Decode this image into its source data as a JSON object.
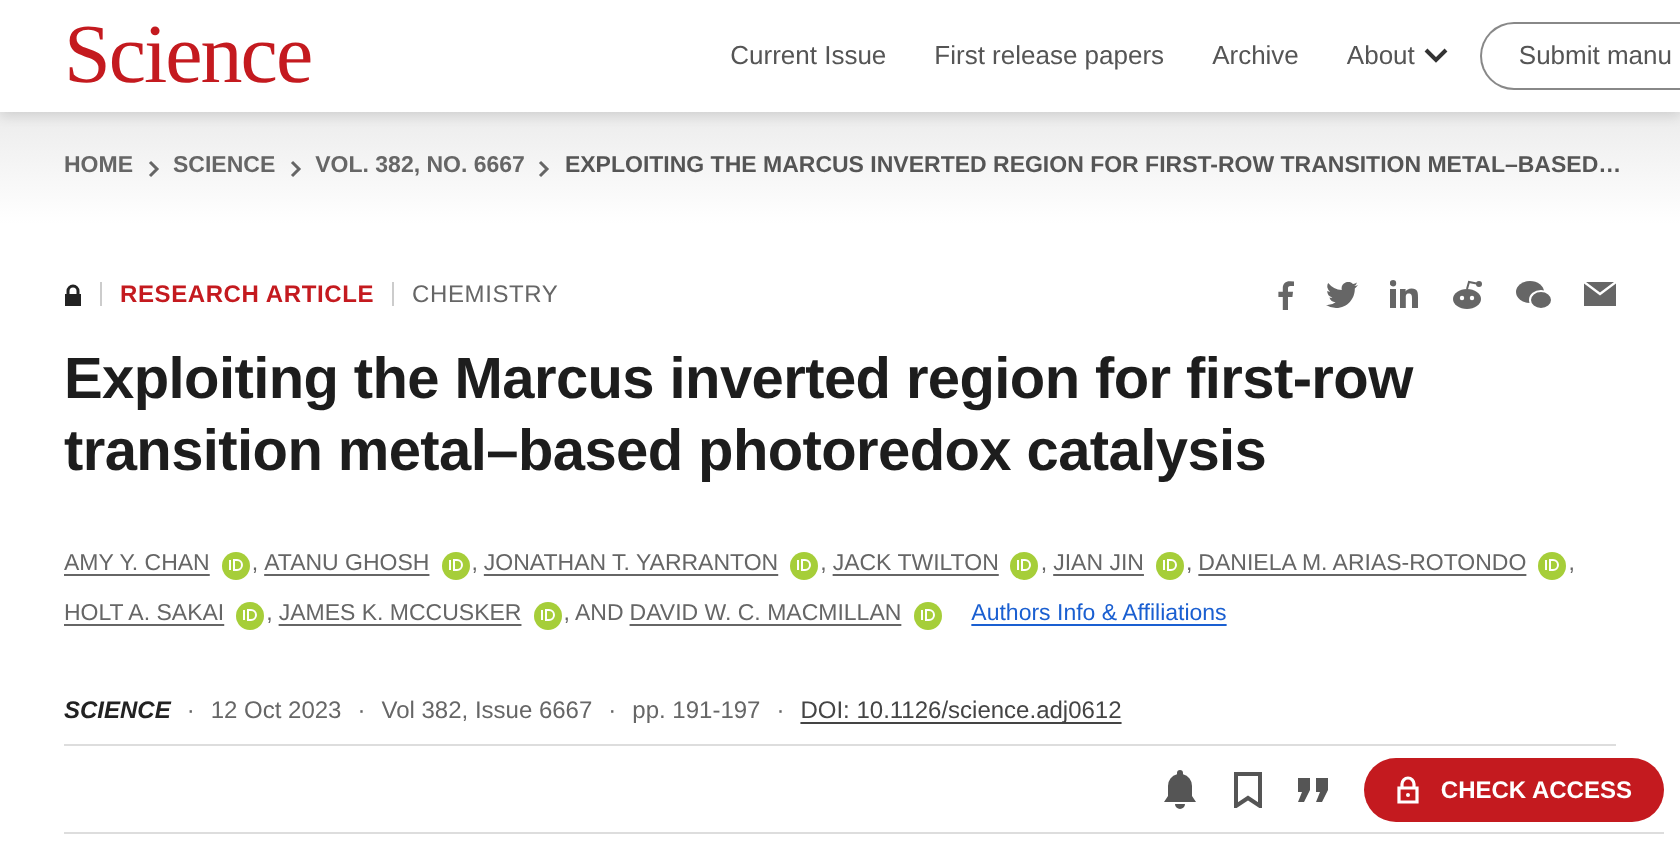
{
  "header": {
    "logo": "Science",
    "nav": [
      {
        "label": "Current Issue",
        "dropdown": false
      },
      {
        "label": "First release papers",
        "dropdown": false
      },
      {
        "label": "Archive",
        "dropdown": false
      },
      {
        "label": "About",
        "dropdown": true
      }
    ],
    "submit_button": "Submit manu"
  },
  "breadcrumb": [
    "HOME",
    "SCIENCE",
    "VOL. 382, NO. 6667",
    "EXPLOITING THE MARCUS INVERTED REGION FOR FIRST-ROW TRANSITION METAL–BASED…"
  ],
  "article": {
    "locked": true,
    "type": "RESEARCH ARTICLE",
    "section": "CHEMISTRY",
    "title": "Exploiting the Marcus inverted region for first-row transition metal–based photoredox catalysis",
    "authors": [
      {
        "name": "AMY Y. CHAN",
        "orcid": true
      },
      {
        "joiner": ",",
        "name": "ATANU GHOSH",
        "orcid": true
      },
      {
        "joiner": ",",
        "name": "JONATHAN T. YARRANTON",
        "orcid": true
      },
      {
        "joiner": ",",
        "name": "JACK TWILTON",
        "orcid": true
      },
      {
        "joiner": ",",
        "name": "JIAN JIN",
        "orcid": true
      },
      {
        "joiner": ",",
        "name": "DANIELA M. ARIAS-ROTONDO",
        "orcid": true
      },
      {
        "joiner": ",",
        "name": "HOLT A. SAKAI",
        "orcid": true
      },
      {
        "joiner": ",",
        "name": "JAMES K. MCCUSKER",
        "orcid": true
      },
      {
        "joiner": ", AND",
        "name": "DAVID W. C. MACMILLAN",
        "orcid": true
      }
    ],
    "affiliations_link": "Authors Info & Affiliations",
    "meta": [
      {
        "kind": "journal",
        "text": "SCIENCE"
      },
      {
        "kind": "sep",
        "text": "·"
      },
      {
        "kind": "text",
        "text": "12 Oct 2023"
      },
      {
        "kind": "sep",
        "text": "·"
      },
      {
        "kind": "text",
        "text": "Vol 382, Issue 6667"
      },
      {
        "kind": "sep",
        "text": "·"
      },
      {
        "kind": "text",
        "text": "pp. 191-197"
      },
      {
        "kind": "sep",
        "text": "·"
      },
      {
        "kind": "link",
        "text": "DOI: 10.1126/science.adj0612"
      }
    ],
    "access_button": "CHECK ACCESS"
  }
}
